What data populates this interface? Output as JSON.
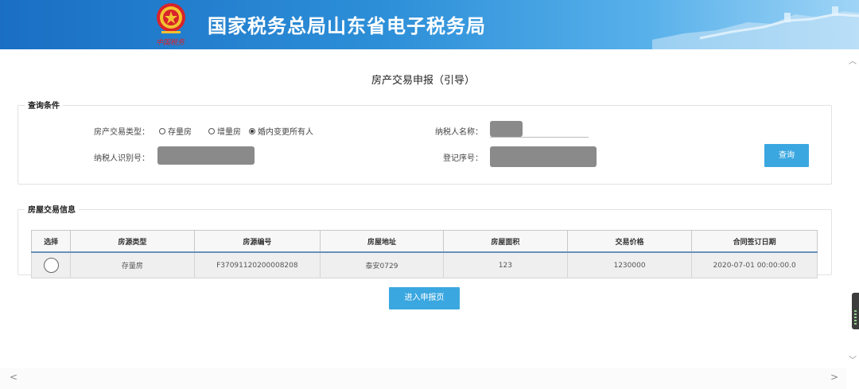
{
  "header": {
    "title": "国家税务总局山东省电子税务局",
    "emblem_caption": "中国税务"
  },
  "page_title": "房产交易申报（引导）",
  "query": {
    "section_label": "查询条件",
    "transaction_type_label": "房产交易类型：",
    "options": [
      {
        "label": "存量房",
        "checked": false
      },
      {
        "label": "增量房",
        "checked": false
      },
      {
        "label": "婚内变更所有人",
        "checked": true
      }
    ],
    "taxpayer_name_label": "纳税人名称：",
    "taxpayer_id_label": "纳税人识别号：",
    "registration_no_label": "登记序号：",
    "search_button": "查询"
  },
  "info": {
    "section_label": "房屋交易信息",
    "columns": [
      "选择",
      "房源类型",
      "房源编号",
      "房屋地址",
      "房屋面积",
      "交易价格",
      "合同签订日期"
    ],
    "rows": [
      {
        "type": "存量房",
        "id": "F37091120200008208",
        "address": "泰安0729",
        "area": "123",
        "price": "1230000",
        "date": "2020-07-01 00:00:00.0"
      }
    ]
  },
  "submit_button": "进入申报页",
  "colors": {
    "banner_start": "#1a6fc4",
    "banner_end": "#9fd4f6",
    "button": "#3ba7e0",
    "header_rule": "#6c8fb8"
  },
  "icons": [
    "national-tax-emblem-icon",
    "radio-icon",
    "scroll-up-icon",
    "scroll-down-icon",
    "scroll-left-icon",
    "scroll-right-icon"
  ]
}
